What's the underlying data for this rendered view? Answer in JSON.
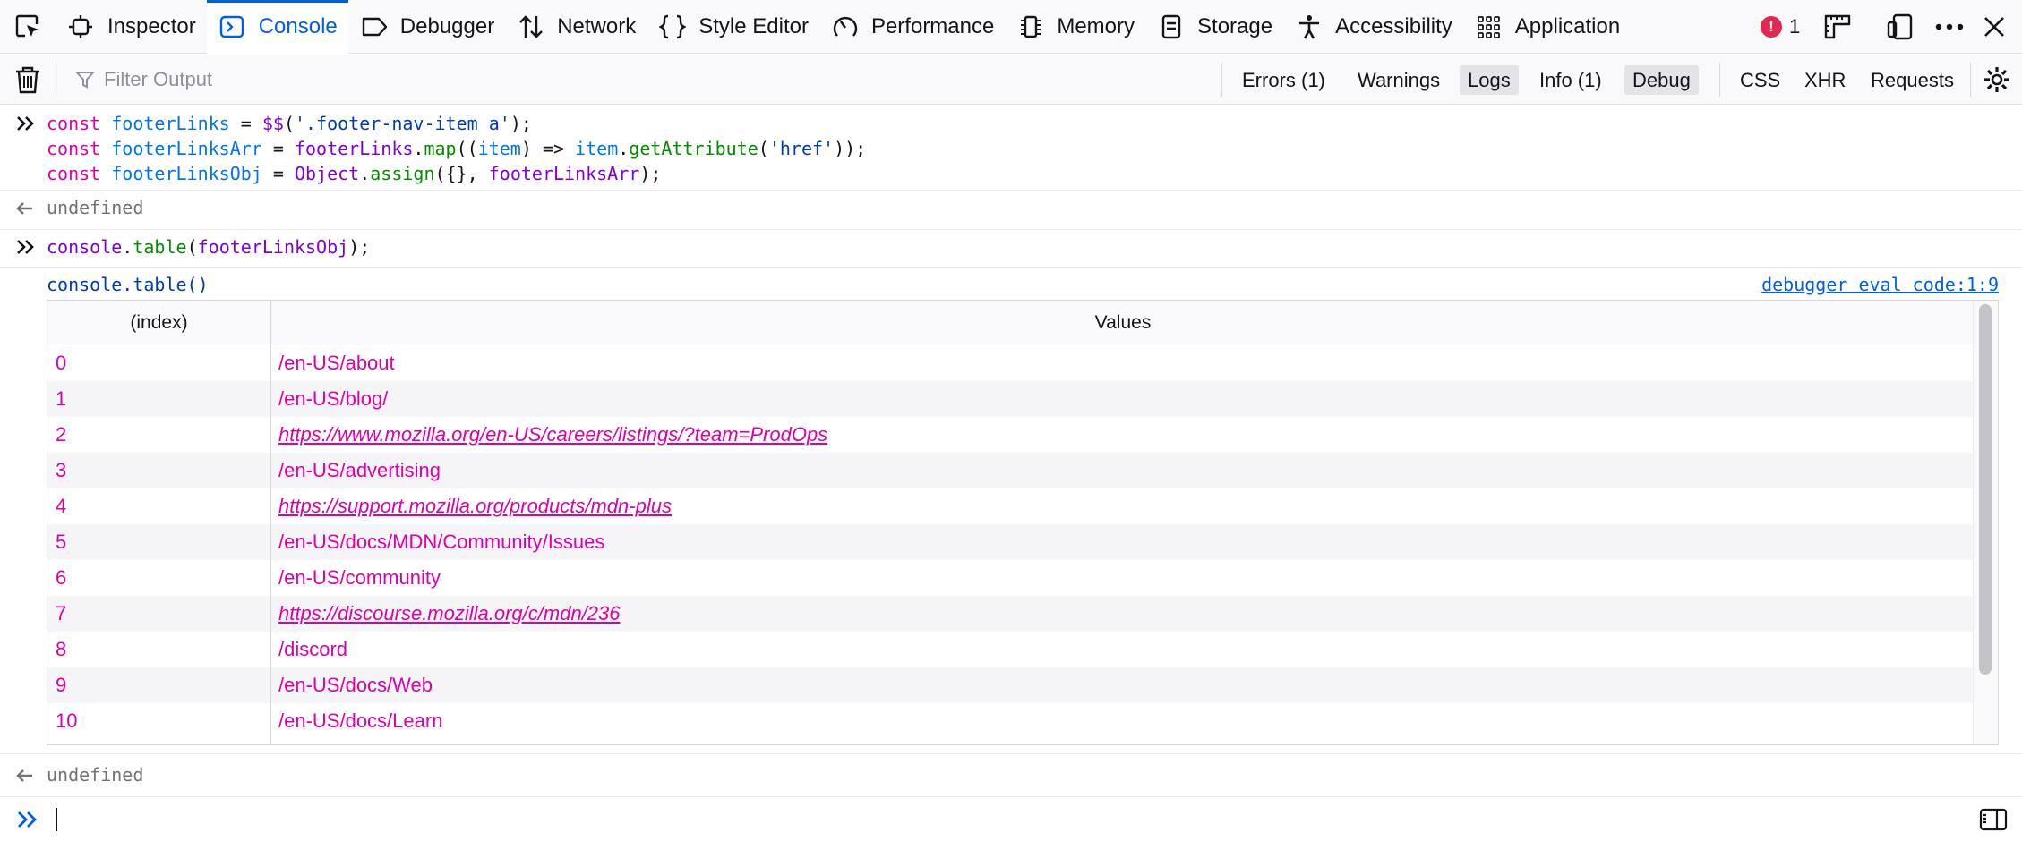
{
  "toolbar": {
    "tabs": [
      {
        "label": "Inspector",
        "icon": "inspector-icon"
      },
      {
        "label": "Console",
        "icon": "console-icon",
        "active": true
      },
      {
        "label": "Debugger",
        "icon": "debugger-icon"
      },
      {
        "label": "Network",
        "icon": "network-icon"
      },
      {
        "label": "Style Editor",
        "icon": "style-editor-icon"
      },
      {
        "label": "Performance",
        "icon": "performance-icon"
      },
      {
        "label": "Memory",
        "icon": "memory-icon"
      },
      {
        "label": "Storage",
        "icon": "storage-icon"
      },
      {
        "label": "Accessibility",
        "icon": "accessibility-icon"
      },
      {
        "label": "Application",
        "icon": "application-icon"
      }
    ],
    "error_count": "1",
    "accent_color": "#0060df",
    "error_color": "#e22850"
  },
  "filterbar": {
    "placeholder": "Filter Output",
    "buttons": [
      {
        "label": "Errors (1)",
        "checked": false
      },
      {
        "label": "Warnings",
        "checked": false
      },
      {
        "label": "Logs",
        "checked": true
      },
      {
        "label": "Info (1)",
        "checked": false
      },
      {
        "label": "Debug",
        "checked": true
      }
    ],
    "net_buttons": [
      "CSS",
      "XHR",
      "Requests"
    ]
  },
  "console": {
    "input1": {
      "line1": {
        "kw": "const",
        "name": "footerLinks",
        "op": " = ",
        "fn": "$$",
        "p1": "(",
        "str": "'.footer-nav-item a'",
        "p2": ");"
      },
      "line2": {
        "kw": "const",
        "name": "footerLinksArr",
        "op": " = ",
        "obj": "footerLinks",
        "dot": ".",
        "fn": "map",
        "p1": "((",
        "arg": "item",
        "p2": ") => ",
        "obj2": "item",
        "dot2": ".",
        "fn2": "getAttribute",
        "p3": "(",
        "str": "'href'",
        "p4": "));"
      },
      "line3": {
        "kw": "const",
        "name": "footerLinksObj",
        "op": " = ",
        "obj": "Object",
        "dot": ".",
        "fn": "assign",
        "p1": "({}, ",
        "arg": "footerLinksArr",
        "p2": ");"
      }
    },
    "result1": "undefined",
    "input2": {
      "obj": "console",
      "dot": ".",
      "fn": "table",
      "p1": "(",
      "arg": "footerLinksObj",
      "p2": ");"
    },
    "table_label": "console.table()",
    "location": "debugger eval code:1:9",
    "result2": "undefined"
  },
  "table": {
    "headers": [
      "(index)",
      "Values"
    ],
    "rows": [
      {
        "index": "0",
        "value": "/en-US/about",
        "url": false
      },
      {
        "index": "1",
        "value": "/en-US/blog/",
        "url": false
      },
      {
        "index": "2",
        "value": "https://www.mozilla.org/en-US/careers/listings/?team=ProdOps",
        "url": true
      },
      {
        "index": "3",
        "value": "/en-US/advertising",
        "url": false
      },
      {
        "index": "4",
        "value": "https://support.mozilla.org/products/mdn-plus",
        "url": true
      },
      {
        "index": "5",
        "value": "/en-US/docs/MDN/Community/Issues",
        "url": false
      },
      {
        "index": "6",
        "value": "/en-US/community",
        "url": false
      },
      {
        "index": "7",
        "value": "https://discourse.mozilla.org/c/mdn/236",
        "url": true
      },
      {
        "index": "8",
        "value": "/discord",
        "url": false
      },
      {
        "index": "9",
        "value": "/en-US/docs/Web",
        "url": false
      },
      {
        "index": "10",
        "value": "/en-US/docs/Learn",
        "url": false
      }
    ]
  }
}
